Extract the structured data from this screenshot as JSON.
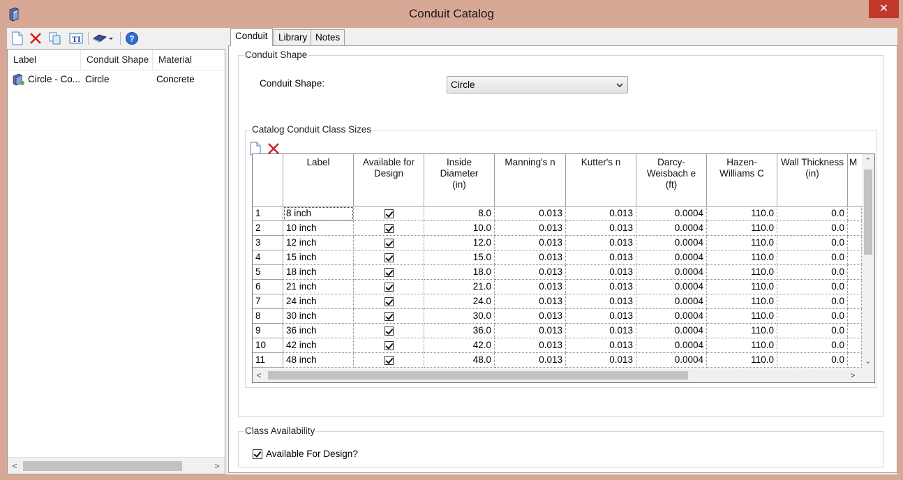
{
  "window": {
    "title": "Conduit Catalog",
    "close_glyph": "✕"
  },
  "left": {
    "columns": [
      "Label",
      "Conduit Shape",
      "Material"
    ],
    "rows": [
      {
        "label": "Circle - Co...",
        "shape": "Circle",
        "material": "Concrete"
      }
    ]
  },
  "tabs": [
    "Conduit",
    "Library",
    "Notes"
  ],
  "conduit_shape": {
    "group_title": "Conduit Shape",
    "field_label": "Conduit Shape:",
    "selected": "Circle"
  },
  "class_sizes": {
    "group_title": "Catalog Conduit Class Sizes",
    "columns": [
      {
        "lines": [
          "Label"
        ]
      },
      {
        "lines": [
          "Available for",
          "Design"
        ]
      },
      {
        "lines": [
          "Inside",
          "Diameter",
          "(in)"
        ]
      },
      {
        "lines": [
          "Manning's n"
        ]
      },
      {
        "lines": [
          "Kutter's n"
        ]
      },
      {
        "lines": [
          "Darcy-",
          "Weisbach e",
          "(ft)"
        ]
      },
      {
        "lines": [
          "Hazen-",
          "Williams C"
        ]
      },
      {
        "lines": [
          "Wall Thickness",
          "(in)"
        ]
      },
      {
        "lines": [
          "M"
        ]
      }
    ],
    "rows": [
      {
        "n": "1",
        "label": "8 inch",
        "available": true,
        "diameter": "8.0",
        "manning": "0.013",
        "kutter": "0.013",
        "darcy": "0.0004",
        "hazen": "110.0",
        "wall": "0.0"
      },
      {
        "n": "2",
        "label": "10 inch",
        "available": true,
        "diameter": "10.0",
        "manning": "0.013",
        "kutter": "0.013",
        "darcy": "0.0004",
        "hazen": "110.0",
        "wall": "0.0"
      },
      {
        "n": "3",
        "label": "12 inch",
        "available": true,
        "diameter": "12.0",
        "manning": "0.013",
        "kutter": "0.013",
        "darcy": "0.0004",
        "hazen": "110.0",
        "wall": "0.0"
      },
      {
        "n": "4",
        "label": "15 inch",
        "available": true,
        "diameter": "15.0",
        "manning": "0.013",
        "kutter": "0.013",
        "darcy": "0.0004",
        "hazen": "110.0",
        "wall": "0.0"
      },
      {
        "n": "5",
        "label": "18 inch",
        "available": true,
        "diameter": "18.0",
        "manning": "0.013",
        "kutter": "0.013",
        "darcy": "0.0004",
        "hazen": "110.0",
        "wall": "0.0"
      },
      {
        "n": "6",
        "label": "21 inch",
        "available": true,
        "diameter": "21.0",
        "manning": "0.013",
        "kutter": "0.013",
        "darcy": "0.0004",
        "hazen": "110.0",
        "wall": "0.0"
      },
      {
        "n": "7",
        "label": "24 inch",
        "available": true,
        "diameter": "24.0",
        "manning": "0.013",
        "kutter": "0.013",
        "darcy": "0.0004",
        "hazen": "110.0",
        "wall": "0.0"
      },
      {
        "n": "8",
        "label": "30 inch",
        "available": true,
        "diameter": "30.0",
        "manning": "0.013",
        "kutter": "0.013",
        "darcy": "0.0004",
        "hazen": "110.0",
        "wall": "0.0"
      },
      {
        "n": "9",
        "label": "36 inch",
        "available": true,
        "diameter": "36.0",
        "manning": "0.013",
        "kutter": "0.013",
        "darcy": "0.0004",
        "hazen": "110.0",
        "wall": "0.0"
      },
      {
        "n": "10",
        "label": "42 inch",
        "available": true,
        "diameter": "42.0",
        "manning": "0.013",
        "kutter": "0.013",
        "darcy": "0.0004",
        "hazen": "110.0",
        "wall": "0.0"
      },
      {
        "n": "11",
        "label": "48 inch",
        "available": true,
        "diameter": "48.0",
        "manning": "0.013",
        "kutter": "0.013",
        "darcy": "0.0004",
        "hazen": "110.0",
        "wall": "0.0"
      }
    ]
  },
  "class_availability": {
    "group_title": "Class Availability",
    "checkbox_label": "Available For Design?",
    "checked": true
  },
  "colors": {
    "title_bar": "#d7a895",
    "close": "#c0392b",
    "icon_blue": "#2a6fc9",
    "icon_red": "#d42020"
  }
}
